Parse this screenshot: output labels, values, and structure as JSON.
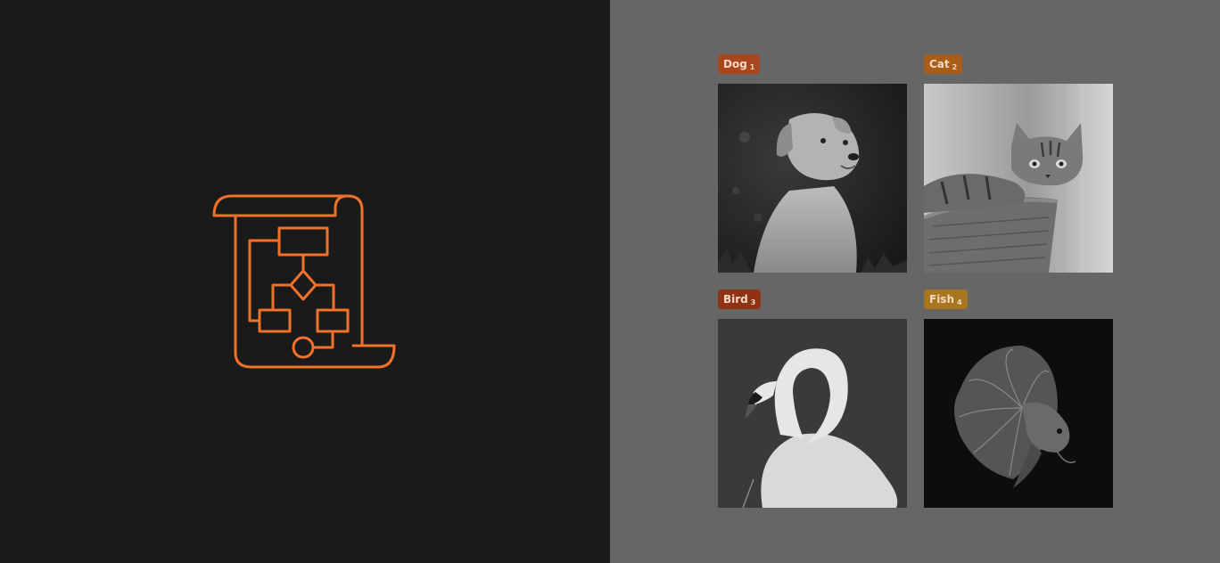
{
  "colors": {
    "left_bg": "#1a1a1a",
    "right_bg": "#666666",
    "icon_stroke": "#f07129"
  },
  "icon": {
    "name": "flowchart-scroll-icon"
  },
  "gallery": {
    "items": [
      {
        "label": "Dog",
        "index": "1",
        "tag_color": "#a8471e",
        "image": "dog-photo"
      },
      {
        "label": "Cat",
        "index": "2",
        "tag_color": "#a85e18",
        "image": "cat-photo"
      },
      {
        "label": "Bird",
        "index": "3",
        "tag_color": "#8e3213",
        "image": "swan-photo"
      },
      {
        "label": "Fish",
        "index": "4",
        "tag_color": "#a8761e",
        "image": "betta-fish-photo"
      }
    ]
  }
}
